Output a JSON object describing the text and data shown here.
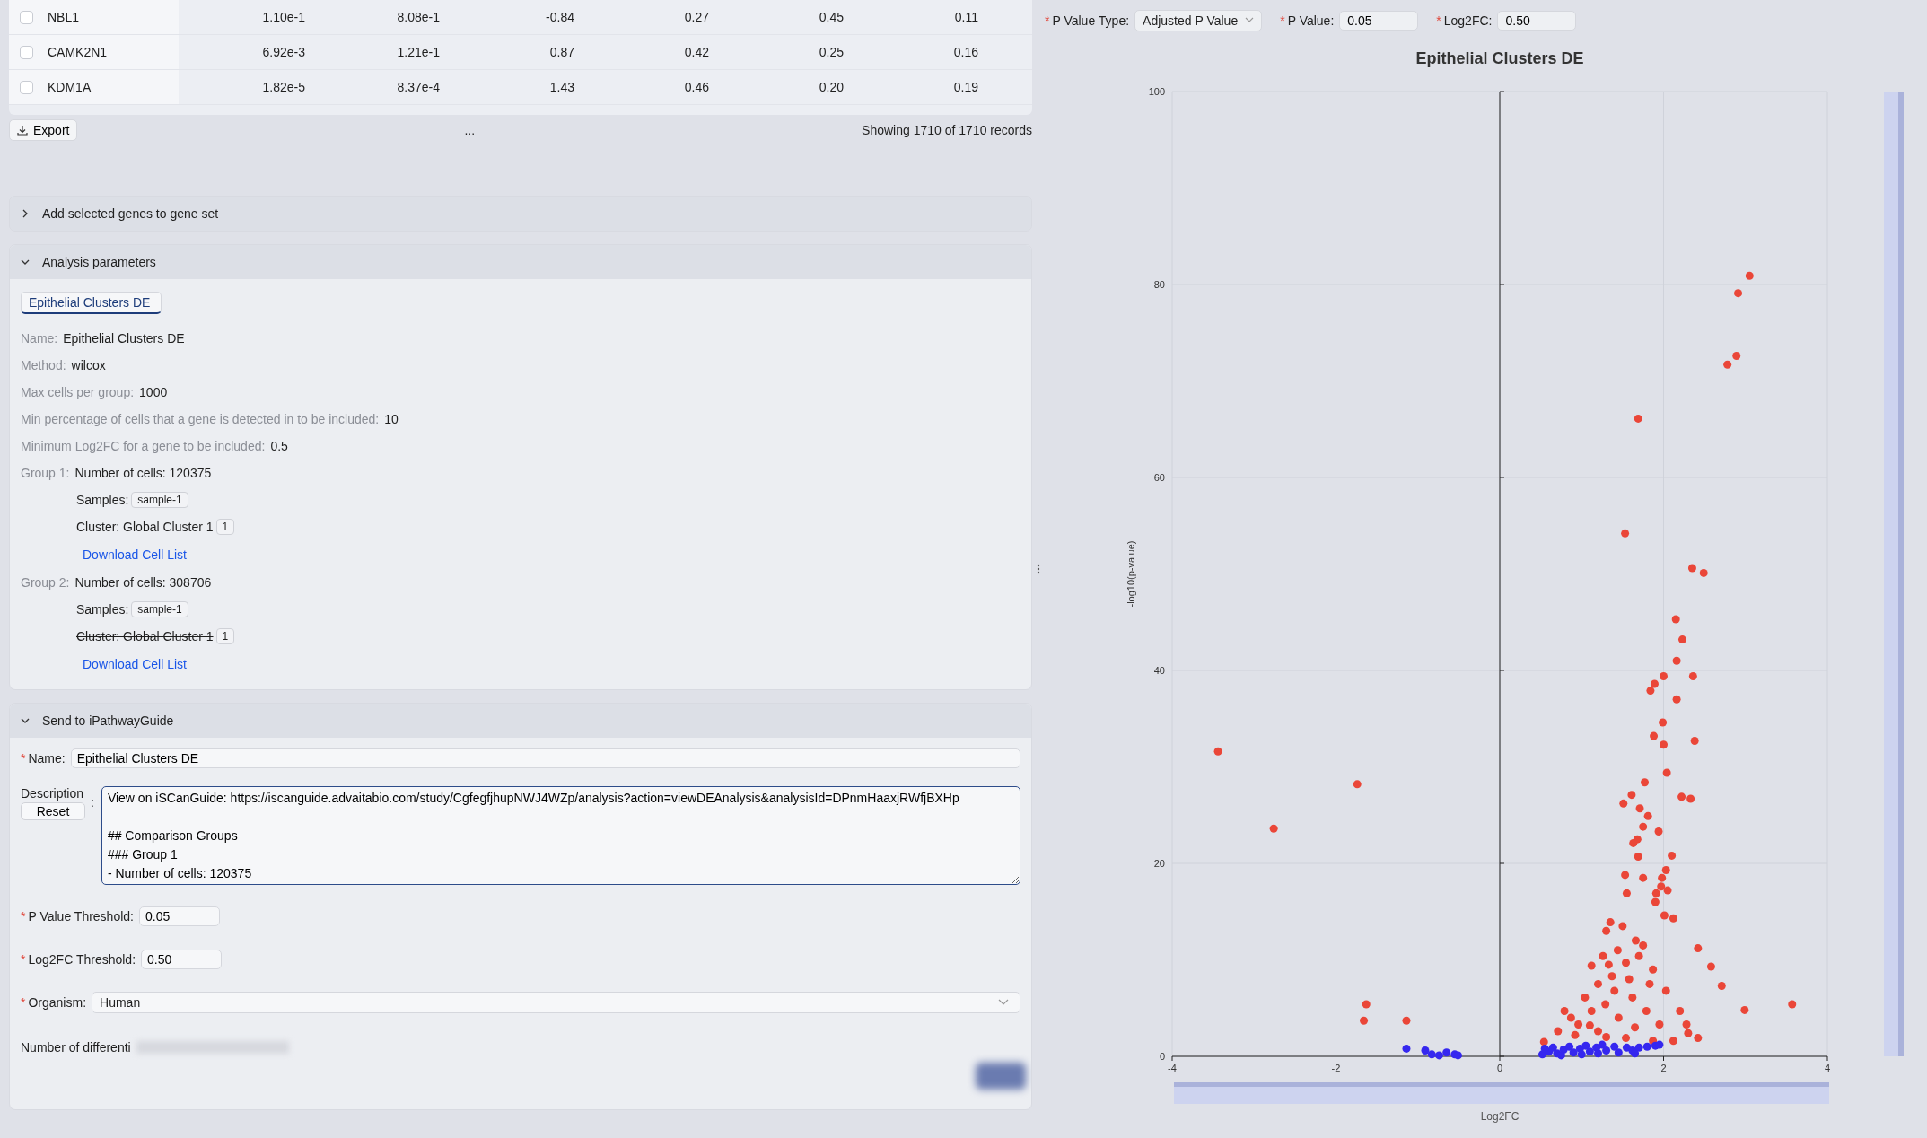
{
  "required_mark": "*",
  "table": {
    "rows": [
      {
        "selected": false,
        "cells": [
          "NBL1",
          "1.10e-1",
          "8.08e-1",
          "-0.84",
          "0.27",
          "0.45",
          "0.11"
        ]
      },
      {
        "selected": false,
        "cells": [
          "CAMK2N1",
          "6.92e-3",
          "1.21e-1",
          "0.87",
          "0.42",
          "0.25",
          "0.16"
        ]
      },
      {
        "selected": false,
        "cells": [
          "KDM1A",
          "1.82e-5",
          "8.37e-4",
          "1.43",
          "0.46",
          "0.20",
          "0.19"
        ]
      }
    ]
  },
  "table_footer": {
    "export": "Export",
    "pagination": "...",
    "summary": "Showing 1710 of 1710 records"
  },
  "gene_set_panel": {
    "title": "Add selected genes to gene set",
    "expanded": false
  },
  "analysis_panel": {
    "title": "Analysis parameters",
    "expanded": true,
    "tabs": [
      {
        "label": "Epithelial Clusters DE",
        "selected": true
      }
    ],
    "fields": [
      {
        "label": "Name:",
        "value": "Epithelial Clusters DE"
      },
      {
        "label": "Method:",
        "value": "wilcox"
      },
      {
        "label": "Max cells per group:",
        "value": "1000"
      },
      {
        "label": "Min percentage of cells that a gene is detected in to be included:",
        "value": "10"
      },
      {
        "label": "Minimum Log2FC for a gene to be included:",
        "value": "0.5"
      }
    ],
    "groups": [
      {
        "label": "Group 1:",
        "cells": "Number of cells: 120375",
        "samples_label": "Samples:",
        "samples": [
          "sample-1"
        ],
        "cluster": "Cluster: Global Cluster 1",
        "cluster_count": "1",
        "struck": false,
        "download": "Download Cell List"
      },
      {
        "label": "Group 2:",
        "cells": "Number of cells: 308706",
        "samples_label": "Samples:",
        "samples": [
          "sample-1"
        ],
        "cluster": "Cluster: Global Cluster 1",
        "cluster_count": "1",
        "struck": true,
        "download": "Download Cell List"
      }
    ]
  },
  "send_panel": {
    "title": "Send to iPathwayGuide",
    "expanded": true,
    "name": {
      "label": "Name:",
      "required": true,
      "value": "Epithelial Clusters DE"
    },
    "description": {
      "label": "Description",
      "reset": "Reset",
      "colon": ":",
      "value": "View on iSCanGuide: https://iscanguide.advaitabio.com/study/CgfegfjhupNWJ4WZp/analysis?action=viewDEAnalysis&analysisId=DPnmHaaxjRWfjBXHp\n\n## Comparison Groups\n### Group 1\n- Number of cells: 120375"
    },
    "thresholds": [
      {
        "label": "P Value Threshold:",
        "required": true,
        "value": "0.05"
      },
      {
        "label": "Log2FC Threshold:",
        "required": true,
        "value": "0.50"
      }
    ],
    "organism": {
      "label": "Organism:",
      "required": true,
      "value": "Human"
    },
    "deg_count": {
      "label": "Number of differenti"
    }
  },
  "filters": [
    {
      "kind": "select",
      "label": "P Value Type:",
      "required": true,
      "value": "Adjusted P Value"
    },
    {
      "kind": "input",
      "label": "P Value:",
      "required": true,
      "value": "0.05"
    },
    {
      "kind": "input",
      "label": "Log2FC:",
      "required": true,
      "value": "0.50"
    }
  ],
  "chart": {
    "chart_data": {
      "type": "scatter",
      "grid": true,
      "title": "Epithelial Clusters DE",
      "xlabel": "Log2FC",
      "ylabel": "-log10(p-value)",
      "xlim": [
        -4,
        4
      ],
      "ylim": [
        0,
        100
      ],
      "xticks": [
        -4,
        -2,
        0,
        2,
        4
      ],
      "yticks": [
        0,
        20,
        40,
        60,
        80,
        100
      ],
      "series": [
        {
          "color": "#ea4638",
          "x": [
            -3.44,
            -2.76,
            -1.74,
            -1.63,
            -1.66,
            -1.14,
            3.05,
            2.91,
            2.89,
            2.78,
            1.69,
            1.53,
            2.35,
            2.49,
            2.15,
            2.23,
            2.16,
            2.0,
            2.36,
            1.89,
            1.84,
            2.16,
            1.99,
            1.88,
            2.0,
            2.38,
            2.04,
            1.77,
            1.61,
            1.51,
            2.22,
            2.33,
            1.71,
            1.81,
            1.94,
            1.75,
            1.68,
            1.63,
            2.1,
            1.69,
            2.03,
            1.53,
            1.75,
            1.98,
            1.97,
            2.05,
            1.91,
            1.55,
            1.9,
            2.12,
            2.01,
            2.42,
            2.58,
            2.71,
            2.99,
            3.57,
            1.12,
            1.35,
            1.3,
            1.26,
            1.5,
            0.54,
            0.71,
            0.87,
            1.04,
            1.2,
            1.37,
            1.54,
            1.7,
            1.87,
            2.03,
            2.2,
            2.28,
            2.42,
            0.79,
            0.96,
            1.12,
            1.29,
            1.45,
            1.62,
            1.79,
            1.95,
            1.2,
            1.54,
            1.87,
            2.12,
            1.4,
            1.58,
            1.66,
            1.44,
            1.33,
            1.75,
            1.83,
            1.1,
            0.92,
            1.65,
            1.3,
            2.3
          ],
          "values": [
            31.6,
            23.6,
            28.2,
            5.4,
            3.7,
            3.7,
            80.9,
            79.1,
            72.6,
            71.7,
            66.1,
            54.2,
            50.6,
            50.1,
            45.3,
            43.2,
            41.0,
            39.4,
            39.4,
            38.6,
            37.9,
            37.0,
            34.6,
            33.2,
            32.3,
            32.7,
            29.4,
            28.4,
            27.1,
            26.2,
            26.9,
            26.7,
            25.7,
            24.9,
            23.3,
            23.8,
            22.5,
            22.1,
            20.8,
            20.7,
            19.3,
            18.8,
            18.5,
            18.5,
            17.6,
            17.2,
            16.9,
            16.9,
            16.0,
            14.3,
            14.6,
            11.2,
            9.3,
            7.3,
            4.8,
            5.4,
            9.4,
            13.9,
            13.0,
            10.4,
            13.5,
            1.5,
            2.6,
            4.0,
            6.1,
            7.5,
            8.3,
            9.7,
            10.4,
            9.0,
            6.8,
            4.7,
            3.3,
            1.9,
            4.7,
            3.3,
            4.7,
            5.4,
            4.0,
            6.1,
            4.7,
            3.3,
            2.6,
            1.9,
            1.6,
            1.6,
            6.8,
            8.0,
            12.0,
            11.0,
            9.5,
            11.5,
            7.5,
            3.2,
            2.2,
            3.0,
            2.0,
            2.4
          ]
        },
        {
          "color": "#3527ef",
          "x": [
            -1.14,
            -0.91,
            -0.83,
            -0.74,
            -0.65,
            -0.55,
            -0.51,
            0.52,
            0.6,
            0.65,
            0.7,
            0.78,
            0.85,
            0.9,
            0.98,
            1.05,
            1.1,
            1.18,
            1.25,
            1.3,
            1.4,
            1.55,
            1.62,
            1.7,
            1.8,
            1.9,
            1.95,
            0.55,
            0.75,
            1.0,
            1.2,
            1.45,
            1.65
          ],
          "values": [
            0.8,
            0.6,
            0.2,
            0.1,
            0.4,
            0.2,
            0.1,
            0.2,
            0.5,
            0.9,
            0.3,
            0.7,
            1.0,
            0.4,
            0.8,
            1.1,
            0.5,
            0.9,
            1.2,
            0.6,
            1.0,
            0.9,
            0.6,
            0.9,
            1.0,
            1.1,
            1.2,
            0.8,
            0.1,
            0.2,
            0.3,
            0.4,
            0.3
          ]
        }
      ]
    }
  }
}
